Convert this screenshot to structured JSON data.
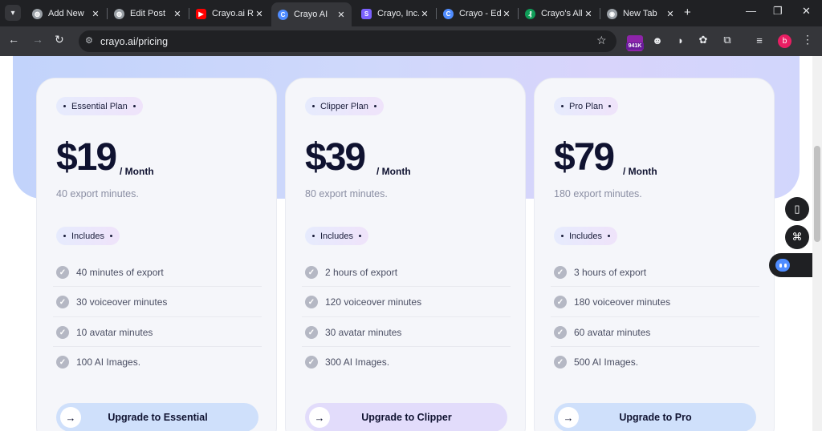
{
  "browser": {
    "tabs": [
      {
        "title": "Add New",
        "favicon_color": "#9aa0a6",
        "active": false
      },
      {
        "title": "Edit Post",
        "favicon_color": "#9aa0a6",
        "active": false
      },
      {
        "title": "Crayo.ai R",
        "favicon_color": "#ff0000",
        "active": false
      },
      {
        "title": "Crayo AI",
        "favicon_color": "#4f8cff",
        "active": true
      },
      {
        "title": "Crayo, Inc.",
        "favicon_color": "#7b61ff",
        "active": false
      },
      {
        "title": "Crayo - Ed",
        "favicon_color": "#4f8cff",
        "active": false
      },
      {
        "title": "Crayo's All",
        "favicon_color": "#0f9d58",
        "active": false
      },
      {
        "title": "New Tab",
        "favicon_color": "#9aa0a6",
        "active": false
      }
    ],
    "url": "crayo.ai/pricing",
    "profile_initial": "b",
    "extension_badge": "941K"
  },
  "plans": [
    {
      "name": "Essential Plan",
      "price": "$19",
      "period": "/ Month",
      "export_minutes": "40 export minutes.",
      "includes_label": "Includes",
      "features": [
        "40 minutes of export",
        "30 voiceover minutes",
        "10 avatar minutes",
        "100 AI Images."
      ],
      "cta": "Upgrade to Essential",
      "cta_color": "#cfe0fb"
    },
    {
      "name": "Clipper Plan",
      "price": "$39",
      "period": "/ Month",
      "export_minutes": "80 export minutes.",
      "includes_label": "Includes",
      "features": [
        "2 hours of export",
        "120 voiceover minutes",
        "30 avatar minutes",
        "300 AI Images."
      ],
      "cta": "Upgrade to Clipper",
      "cta_color": "#e2dcfb"
    },
    {
      "name": "Pro Plan",
      "price": "$79",
      "period": "/ Month",
      "export_minutes": "180 export minutes.",
      "includes_label": "Includes",
      "features": [
        "3 hours of export",
        "180 voiceover minutes",
        "60 avatar minutes",
        "500 AI Images."
      ],
      "cta": "Upgrade to Pro",
      "cta_color": "#cfe0fb"
    }
  ],
  "colors": {
    "heading": "#0f1230",
    "muted": "#8a8ea3",
    "hero_gradient_start": "#c2d3fb",
    "hero_gradient_end": "#d1d6fc"
  }
}
